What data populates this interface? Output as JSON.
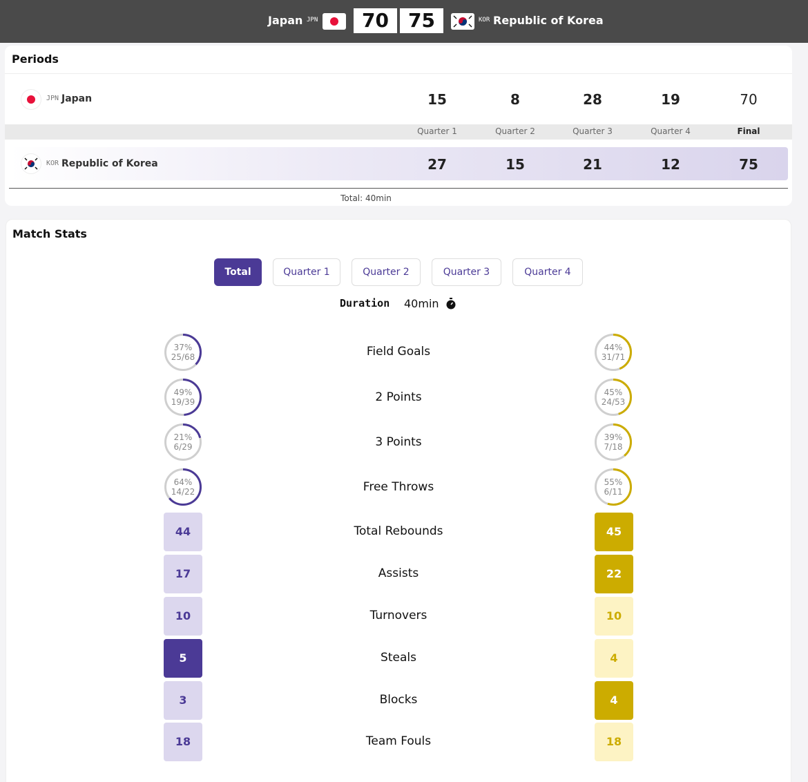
{
  "header": {
    "home": {
      "name": "Japan",
      "code": "JPN",
      "score": "70",
      "flag": "japan-flag-icon"
    },
    "away": {
      "name": "Republic of Korea",
      "code": "KOR",
      "score": "75",
      "flag": "korea-flag-icon"
    }
  },
  "periods": {
    "title": "Periods",
    "home": {
      "code": "JPN",
      "name": "Japan",
      "scores": [
        "15",
        "8",
        "28",
        "19",
        "70"
      ]
    },
    "away": {
      "code": "KOR",
      "name": "Republic of Korea",
      "scores": [
        "27",
        "15",
        "21",
        "12",
        "75"
      ]
    },
    "labels": [
      "Quarter 1",
      "Quarter 2",
      "Quarter 3",
      "Quarter 4",
      "Final"
    ],
    "total": "Total: 40min"
  },
  "match_stats": {
    "title": "Match Stats",
    "tabs": [
      "Total",
      "Quarter 1",
      "Quarter 2",
      "Quarter 3",
      "Quarter 4"
    ],
    "active_tab": "Total",
    "duration_label": "Duration",
    "duration_value": "40min",
    "colors": {
      "home": "#4b3a96",
      "home_light": "#dcd7ee",
      "away": "#ccac00",
      "away_light": "#fdf3c4"
    },
    "shooting": [
      {
        "label": "Field Goals",
        "home_pct": "37%",
        "home_ratio": "25/68",
        "home_frac": 0.37,
        "away_pct": "44%",
        "away_ratio": "31/71",
        "away_frac": 0.44
      },
      {
        "label": "2 Points",
        "home_pct": "49%",
        "home_ratio": "19/39",
        "home_frac": 0.49,
        "away_pct": "45%",
        "away_ratio": "24/53",
        "away_frac": 0.45
      },
      {
        "label": "3 Points",
        "home_pct": "21%",
        "home_ratio": "6/29",
        "home_frac": 0.21,
        "away_pct": "39%",
        "away_ratio": "7/18",
        "away_frac": 0.39
      },
      {
        "label": "Free Throws",
        "home_pct": "64%",
        "home_ratio": "14/22",
        "home_frac": 0.64,
        "away_pct": "55%",
        "away_ratio": "6/11",
        "away_frac": 0.55
      }
    ],
    "counts": [
      {
        "label": "Total Rebounds",
        "home": "44",
        "away": "45",
        "leader": "away"
      },
      {
        "label": "Assists",
        "home": "17",
        "away": "22",
        "leader": "away"
      },
      {
        "label": "Turnovers",
        "home": "10",
        "away": "10",
        "leader": "none"
      },
      {
        "label": "Steals",
        "home": "5",
        "away": "4",
        "leader": "home"
      },
      {
        "label": "Blocks",
        "home": "3",
        "away": "4",
        "leader": "away"
      },
      {
        "label": "Team Fouls",
        "home": "18",
        "away": "18",
        "leader": "none"
      }
    ]
  }
}
